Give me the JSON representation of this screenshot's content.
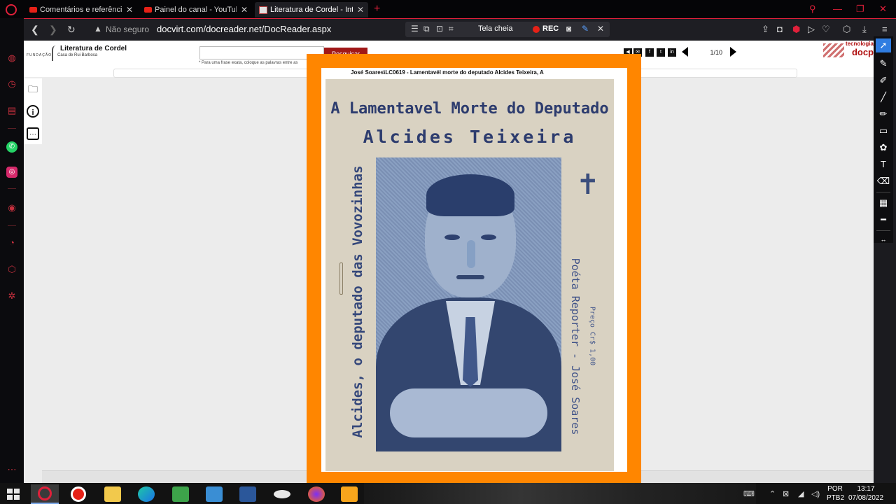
{
  "browser": {
    "tabs": [
      {
        "title": "Comentários e referências a",
        "type": "youtube",
        "active": false
      },
      {
        "title": "Painel do canal - YouTube S",
        "type": "youtube",
        "active": false
      },
      {
        "title": "Literatura de Cordel - Intern",
        "type": "page",
        "active": true
      }
    ],
    "new_tab": "+",
    "security_label": "Não seguro",
    "url": "docvirt.com/docreader.net/DocReader.aspx",
    "capture_bar": {
      "fullscreen_label": "Tela cheia",
      "rec_label": "REC"
    },
    "accent_color": "#e0203a"
  },
  "site": {
    "fundacao_label": "FUNDAÇÃO",
    "logo_title": "Literatura de Cordel",
    "logo_subtitle": "Casa de Rui Barbosa",
    "search_placeholder": "",
    "search_button": "Pesquisar",
    "search_hint": "* Para uma frase exata, coloque as palavras entre as",
    "share_icons": [
      "share-icon",
      "email-icon",
      "facebook-icon",
      "twitter-icon",
      "linkedin-icon"
    ],
    "share_glyphs": [
      "◀",
      "✉",
      "f",
      "t",
      "in"
    ],
    "page_indicator": "1/10",
    "brand_top": "tecnologia",
    "brand_bottom": "docp"
  },
  "document": {
    "caption": "José Soares\\LC0619 - Lamentavél morte do deputado Alcides Teixeira, A",
    "cover_title_line1": "A Lamentavel Morte do Deputado",
    "cover_title_line2": "Alcides Teixeira",
    "cover_left_text": "Alcides, o deputado das Vovozinhas",
    "cover_right_text": "Poéta Reporter - José Soares",
    "cover_price": "Preço Cr$ 1,00",
    "cross_glyph": "✝"
  },
  "taskbar": {
    "language_top": "POR",
    "language_bottom": "PTB2",
    "time": "13:17",
    "date": "07/08/2022"
  }
}
